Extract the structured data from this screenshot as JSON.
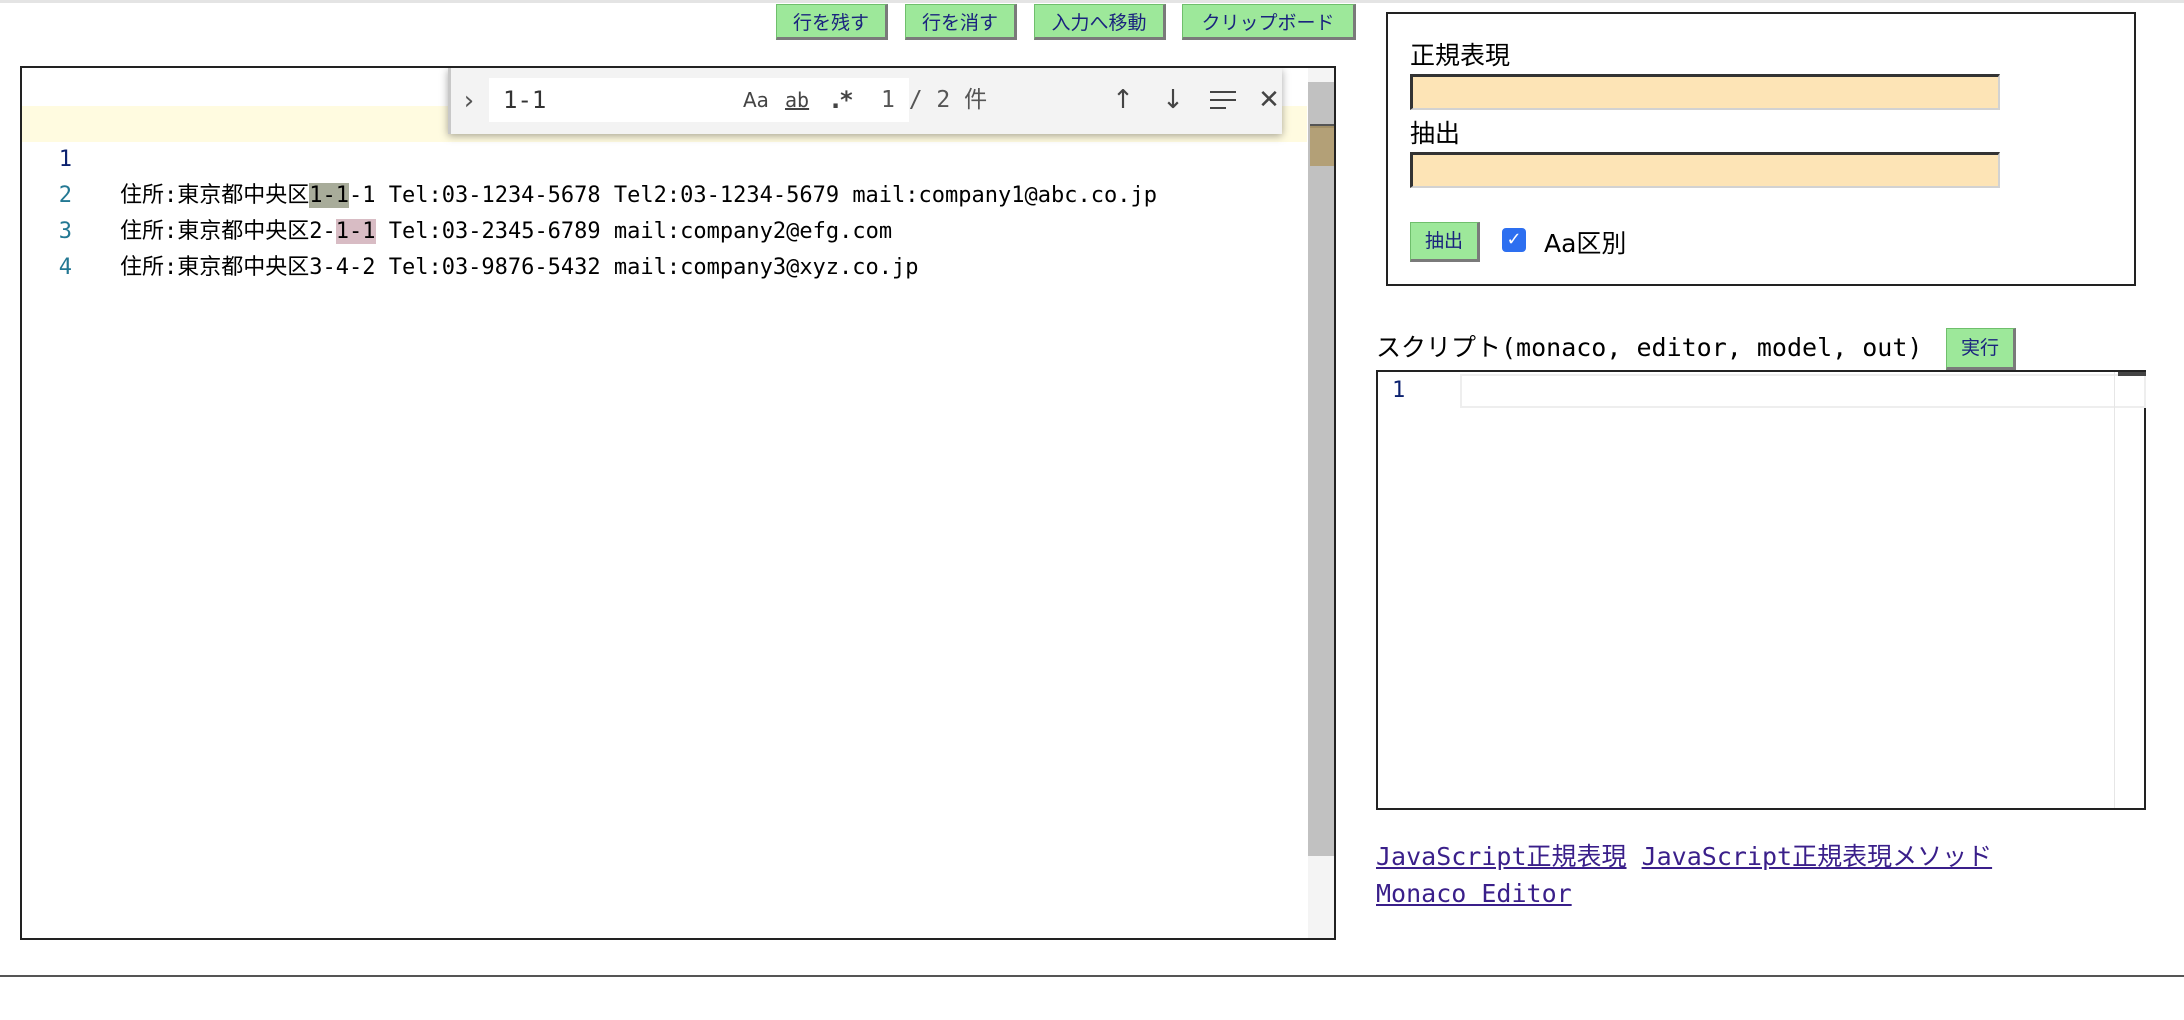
{
  "toolbar": {
    "keep_lines": "行を残す",
    "delete_lines": "行を消す",
    "move_to_input": "入力へ移動",
    "clipboard": "クリップボード"
  },
  "editor": {
    "lines": [
      {
        "number": "1",
        "before": "住所:東京都中央区",
        "match": "1-1",
        "after": "-1 Tel:03-1234-5678 Tel2:03-1234-5679 mail:company1@abc.co.jp"
      },
      {
        "number": "2",
        "before": "住所:東京都中央区2-",
        "match": "1-1",
        "after": " Tel:03-2345-6789 mail:company2@efg.com"
      },
      {
        "number": "3",
        "text": "住所:東京都中央区3-4-2 Tel:03-9876-5432 mail:company3@xyz.co.jp"
      },
      {
        "number": "4",
        "text": ""
      }
    ]
  },
  "find": {
    "query": "1-1",
    "match_case": "Aa",
    "whole_word": "ab",
    "regex": ".*",
    "count": "1 / 2 件",
    "icons": [
      "chevron-right-icon",
      "arrow-up-icon",
      "arrow-down-icon",
      "selection-icon",
      "close-icon"
    ]
  },
  "panel": {
    "regex_label": "正規表現",
    "regex_value": "",
    "extract_label": "抽出",
    "extract_value": "",
    "extract_button": "抽出",
    "case_label": "Aa区別",
    "case_checked": true
  },
  "script": {
    "label": "スクリプト(monaco, editor, model, out)",
    "run_button": "実行",
    "line_number": "1"
  },
  "links": {
    "regex": "JavaScript正規表現",
    "regex_methods": "JavaScript正規表現メソッド",
    "monaco": "Monaco Editor"
  },
  "colors": {
    "button_bg": "#9de89a",
    "button_text": "#1a237e",
    "input_bg": "#fde4b6",
    "current_match": "#a8ac9a",
    "other_match": "#d8bcc4",
    "current_line": "#fffbe0"
  }
}
